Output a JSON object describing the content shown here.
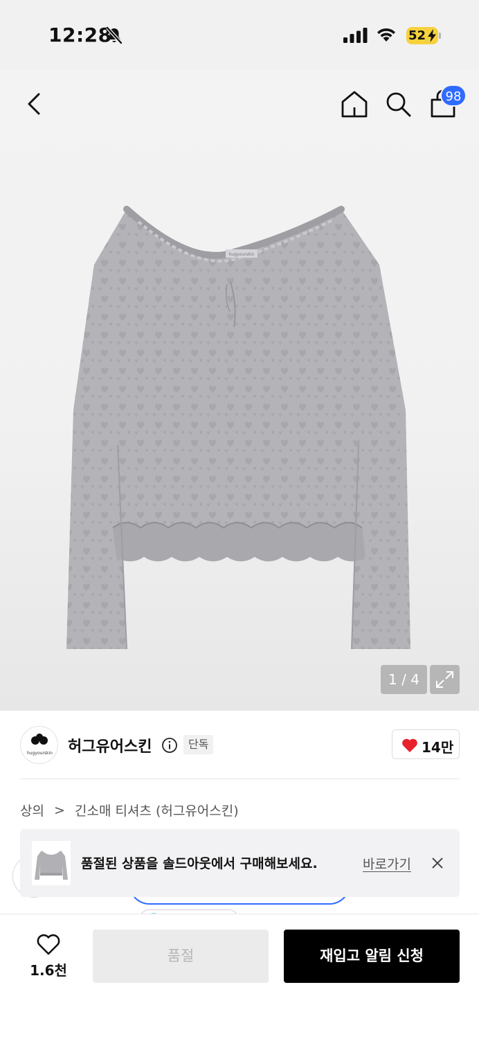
{
  "status_bar": {
    "time": "12:28",
    "battery": "52"
  },
  "header": {
    "cart_count": "98"
  },
  "gallery": {
    "page_indicator": "1 / 4",
    "current_page": 1,
    "total_pages": 4,
    "tag_text": "hugyourskin"
  },
  "brand": {
    "logo_text": "hugyourskin",
    "name": "허그유어스킨",
    "badge": "단독",
    "like_count": "14만"
  },
  "breadcrumb": {
    "category": "상의",
    "separator": ">",
    "subcategory": "긴소매 티셔츠 (허그유어스킨)"
  },
  "soldout_banner": {
    "message": "품절된 상품을 솔드아웃에서 구매해보세요.",
    "link": "바로가기"
  },
  "bottom_bar": {
    "wish_count": "1.6천",
    "soldout_label": "품절",
    "restock_label": "재입고 알림 신청"
  },
  "colors": {
    "accent_blue": "#2f6bff",
    "battery_yellow": "#f7d13b",
    "heart_red": "#e8202a",
    "primary_black": "#000000"
  },
  "icons": [
    "bell-off-icon",
    "signal-icon",
    "wifi-icon",
    "battery-icon",
    "back-icon",
    "home-icon",
    "search-icon",
    "cart-icon",
    "expand-icon",
    "info-icon",
    "heart-filled-icon",
    "chevron-right-icon",
    "close-icon",
    "heart-outline-icon"
  ]
}
